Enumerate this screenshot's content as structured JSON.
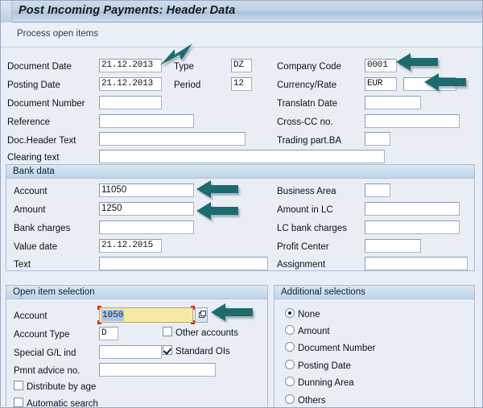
{
  "window": {
    "title": "Post Incoming Payments: Header Data",
    "subtitle": "Process open items"
  },
  "header_form": {
    "left": [
      {
        "label": "Document Date",
        "value": "21.12.2013"
      },
      {
        "label": "Posting Date",
        "value": "21.12.2013"
      },
      {
        "label": "Document Number",
        "value": ""
      },
      {
        "label": "Reference",
        "value": ""
      },
      {
        "label": "Doc.Header Text",
        "value": ""
      },
      {
        "label": "Clearing text",
        "value": ""
      }
    ],
    "middle": [
      {
        "label": "Type",
        "value": "DZ"
      },
      {
        "label": "Period",
        "value": "12"
      }
    ],
    "right": [
      {
        "label": "Company Code",
        "value": "0001"
      },
      {
        "label": "Currency/Rate",
        "value": "EUR",
        "value2": ""
      },
      {
        "label": "Translatn Date",
        "value": ""
      },
      {
        "label": "Cross-CC no.",
        "value": ""
      },
      {
        "label": "Trading part.BA",
        "value": ""
      }
    ]
  },
  "bank_data": {
    "title": "Bank data",
    "left": [
      {
        "label": "Account",
        "value": "11050"
      },
      {
        "label": "Amount",
        "value": "1250"
      },
      {
        "label": "Bank charges",
        "value": ""
      },
      {
        "label": "Value date",
        "value": "21.12.2015"
      },
      {
        "label": "Text",
        "value": ""
      }
    ],
    "right": [
      {
        "label": "Business Area",
        "value": ""
      },
      {
        "label": "Amount in LC",
        "value": ""
      },
      {
        "label": "LC bank charges",
        "value": ""
      },
      {
        "label": "Profit Center",
        "value": ""
      },
      {
        "label": "Assignment",
        "value": ""
      }
    ]
  },
  "open_item_selection": {
    "title": "Open item selection",
    "account": {
      "label": "Account",
      "value": "1050"
    },
    "account_type": {
      "label": "Account Type",
      "value": "D"
    },
    "special_gl": {
      "label": "Special G/L ind",
      "value": ""
    },
    "pmnt_advice": {
      "label": "Pmnt advice no.",
      "value": ""
    },
    "checkboxes": [
      {
        "label": "Other accounts",
        "checked": false
      },
      {
        "label": "Standard OIs",
        "checked": true
      },
      {
        "label": "Distribute by age",
        "checked": false
      },
      {
        "label": "Automatic search",
        "checked": false
      }
    ]
  },
  "additional_selections": {
    "title": "Additional selections",
    "options": [
      {
        "label": "None",
        "selected": true
      },
      {
        "label": "Amount",
        "selected": false
      },
      {
        "label": "Document Number",
        "selected": false
      },
      {
        "label": "Posting Date",
        "selected": false
      },
      {
        "label": "Dunning Area",
        "selected": false
      },
      {
        "label": "Others",
        "selected": false
      }
    ]
  },
  "annotations": {
    "arrow_color": "#1d6b6e",
    "arrows": [
      {
        "name": "arrow-to-document-date",
        "direction": "diagonal-down-left"
      },
      {
        "name": "arrow-to-company-code",
        "direction": "left"
      },
      {
        "name": "arrow-to-currency-rate",
        "direction": "left"
      },
      {
        "name": "arrow-to-bank-account",
        "direction": "left"
      },
      {
        "name": "arrow-to-bank-amount",
        "direction": "left"
      },
      {
        "name": "arrow-to-oi-account",
        "direction": "left"
      }
    ]
  }
}
